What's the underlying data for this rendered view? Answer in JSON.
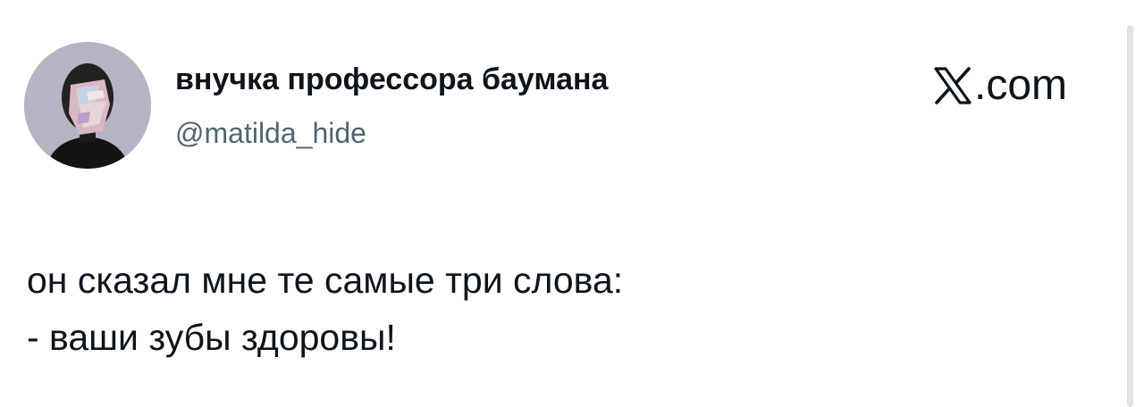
{
  "author": {
    "display_name": "внучка профессора баумана",
    "handle": "@matilda_hide",
    "avatar_icon": "user-avatar-photo"
  },
  "brand": {
    "icon": "x-logo-icon",
    "text": ".com"
  },
  "tweet": {
    "line1": "он сказал мне те самые три слова:",
    "line2": "- ваши зубы здоровы!"
  },
  "colors": {
    "text_primary": "#0f1419",
    "text_secondary": "#536471",
    "avatar_bg": "#b6b3c3"
  }
}
